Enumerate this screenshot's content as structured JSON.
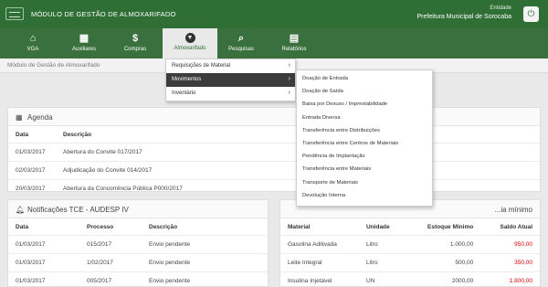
{
  "header": {
    "app_title": "MÓDULO DE GESTÃO DE ALMOXARIFADO",
    "entity_label": "Entidade",
    "entity_name": "Prefeitura Municipal de Sorocaba",
    "logout_icon": "power-icon"
  },
  "nav": {
    "items": [
      {
        "label": "VGA",
        "icon": "home-icon"
      },
      {
        "label": "Auxiliares",
        "icon": "grid-icon"
      },
      {
        "label": "Compras",
        "icon": "dollar-icon"
      },
      {
        "label": "Almoxarifado",
        "icon": "circle-down-icon"
      },
      {
        "label": "Pesquisas",
        "icon": "search-icon"
      },
      {
        "label": "Relatórios",
        "icon": "document-icon"
      }
    ]
  },
  "breadcrumb": "Módulo de Gestão de Almoxarifado",
  "submenu": {
    "items": [
      {
        "label": "Requisições de Material"
      },
      {
        "label": "Movimentos"
      },
      {
        "label": "Inventário"
      }
    ]
  },
  "flyout": {
    "items": [
      "Doação de Entrada",
      "Doação de Saída",
      "Baixa por Desuso / Imprestabilidade",
      "Entrada Diversa",
      "Transferência entre Distribuições",
      "Transferência entre Centros de Materiais",
      "Pendência de Implantação",
      "Transferência entre Materiais",
      "Transporte de Materiais",
      "Devolução Interna"
    ]
  },
  "agenda": {
    "title": "Agenda",
    "columns": [
      "Data",
      "Descrição"
    ],
    "rows": [
      {
        "date": "01/03/2017",
        "desc": "Abertura do Convite 017/2017"
      },
      {
        "date": "02/03/2017",
        "desc": "Adjudicação do Convite 014/2017"
      },
      {
        "date": "20/03/2017",
        "desc": "Abertura da Concorrência Pública P000/2017"
      }
    ]
  },
  "notifications": {
    "title": "Notificações TCE - AUDESP IV",
    "columns": [
      "Data",
      "Processo",
      "Descrição"
    ],
    "rows": [
      {
        "date": "01/03/2017",
        "process": "015/2017",
        "desc": "Envio pendente"
      },
      {
        "date": "01/03/2017",
        "process": "1/02/2017",
        "desc": "Envio pendente"
      },
      {
        "date": "01/03/2017",
        "process": "005/2017",
        "desc": "Envio pendente"
      }
    ]
  },
  "stock": {
    "title_suffix": "...ia mínimo",
    "columns": [
      "Material",
      "Unidade",
      "Estoque Mínimo",
      "Saldo Atual"
    ],
    "rows": [
      {
        "material": "Gasolina Aditivada",
        "unit": "Litro",
        "min": "1.000,00",
        "balance": "950,00"
      },
      {
        "material": "Leite Integral",
        "unit": "Litro",
        "min": "500,00",
        "balance": "350,00"
      },
      {
        "material": "Insulina Injetável",
        "unit": "UN",
        "min": "2000,00",
        "balance": "1.800,00"
      }
    ]
  },
  "colors": {
    "header_green": "#2f6e35",
    "nav_green": "#39703e",
    "alert_red": "#d40000"
  }
}
